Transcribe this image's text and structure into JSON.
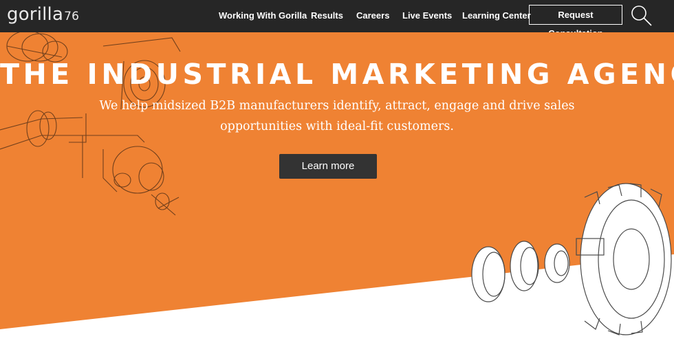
{
  "brand": {
    "logo_text": "gorilla",
    "logo_number": "76"
  },
  "nav": {
    "items": [
      {
        "label": "Working With Gorilla"
      },
      {
        "label": "Results"
      },
      {
        "label": "Careers"
      },
      {
        "label": "Live Events"
      },
      {
        "label": "Learning Center"
      }
    ],
    "cta_label": "Request Consultation"
  },
  "hero": {
    "headline": "THE INDUSTRIAL MARKETING AGENCY",
    "subline_1": "We help midsized B2B manufacturers identify, attract, engage and drive sales",
    "subline_2": "opportunities with ideal-fit customers.",
    "button_label": "Learn more"
  },
  "colors": {
    "nav_bg": "#262626",
    "hero_orange": "#ef8233",
    "button_bg": "#333333",
    "white": "#ffffff"
  }
}
